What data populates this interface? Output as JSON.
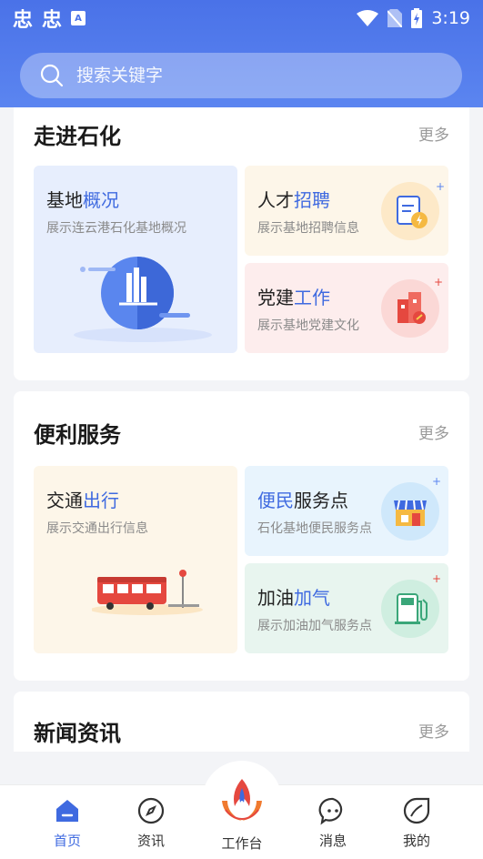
{
  "status_bar": {
    "time": "3:19",
    "left_glyphs": [
      "忠",
      "忠"
    ],
    "mini_icon_letter": "A"
  },
  "search": {
    "placeholder": "搜索关键字"
  },
  "section_about": {
    "title": "走进石化",
    "more": "更多",
    "tiles": [
      {
        "title_plain": "基地",
        "title_highlight": "概况",
        "subtitle": "展示连云港石化基地概况",
        "icon": "building-pie-illustration"
      },
      {
        "title_plain": "人才",
        "title_highlight": "招聘",
        "subtitle": "展示基地招聘信息",
        "icon": "resume-icon"
      },
      {
        "title_plain": "党建",
        "title_highlight": "工作",
        "subtitle": "展示基地党建文化",
        "icon": "party-building-icon"
      }
    ]
  },
  "section_services": {
    "title": "便利服务",
    "more": "更多",
    "tiles": [
      {
        "title_plain": "交通",
        "title_highlight": "出行",
        "subtitle": "展示交通出行信息",
        "icon": "bus-illustration"
      },
      {
        "title_highlight": "便民",
        "title_plain": "服务点",
        "subtitle": "石化基地便民服务点",
        "icon": "store-icon"
      },
      {
        "title_plain": "加油",
        "title_highlight": "加气",
        "subtitle": "展示加油加气服务点",
        "icon": "fuel-pump-icon"
      }
    ]
  },
  "section_news": {
    "title": "新闻资讯",
    "more": "更多"
  },
  "bottom_nav": [
    {
      "label": "首页",
      "icon": "home-icon",
      "active": true
    },
    {
      "label": "资讯",
      "icon": "compass-icon",
      "active": false
    },
    {
      "label": "工作台",
      "icon": "logo-icon",
      "active": false
    },
    {
      "label": "消息",
      "icon": "chat-icon",
      "active": false
    },
    {
      "label": "我的",
      "icon": "leaf-icon",
      "active": false
    }
  ],
  "colors": {
    "primary": "#3f6ae0",
    "header": "#4a72e8",
    "accent_red": "#e5483f"
  }
}
